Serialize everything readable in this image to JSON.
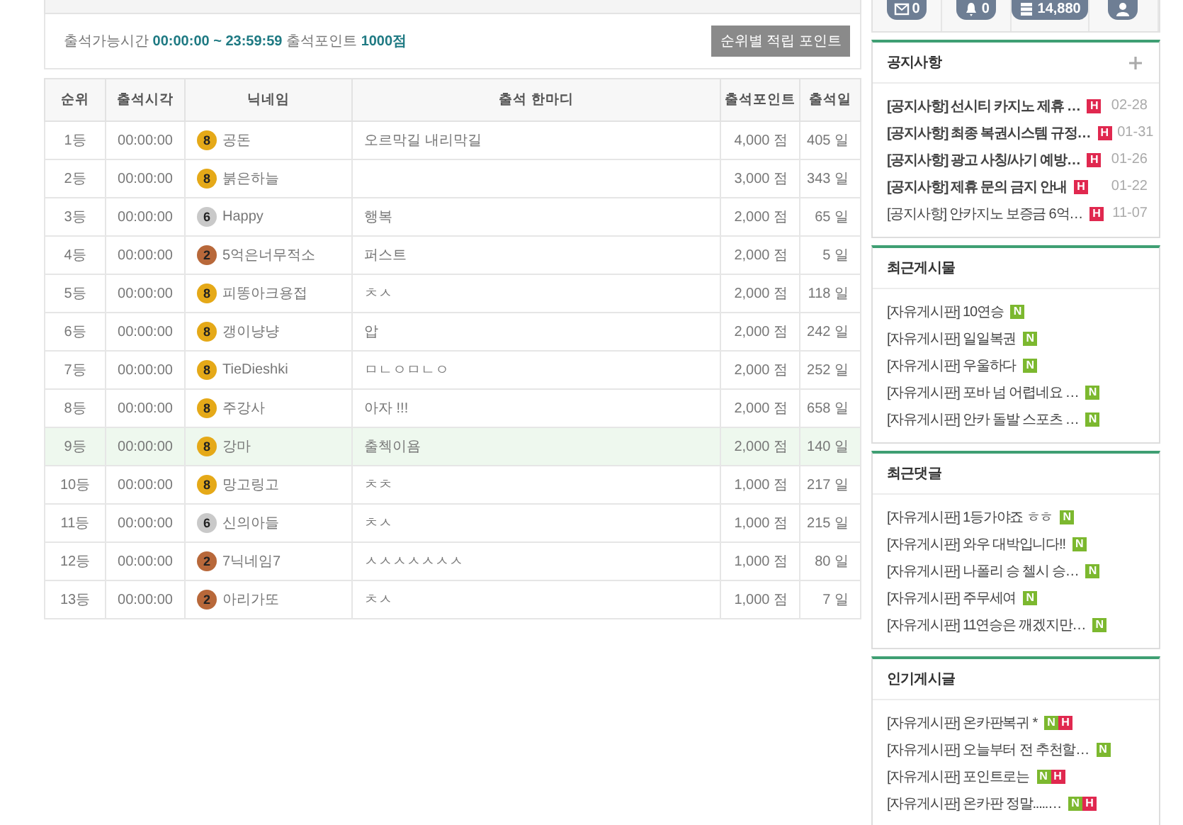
{
  "attendance": {
    "info": "출석가능시간 **00:00:00 ~ 23:59:59** 출석포인트 **1000점**",
    "button": "순위별 적립 포인트"
  },
  "table": {
    "columns": [
      "순위",
      "출석시각",
      "닉네임",
      "출석 한마디",
      "출석포인트",
      "출석일"
    ],
    "rows": [
      {
        "rank": "1등",
        "time": "00:00:00",
        "level": {
          "label": "8",
          "kind": "gold"
        },
        "nickname": "공돈",
        "comment": "오르막길 내리막길",
        "points": "4,000 점",
        "days": "405 일",
        "selected": false
      },
      {
        "rank": "2등",
        "time": "00:00:00",
        "level": {
          "label": "8",
          "kind": "gold"
        },
        "nickname": "붉은하늘",
        "comment": "",
        "points": "3,000 점",
        "days": "343 일",
        "selected": false
      },
      {
        "rank": "3등",
        "time": "00:00:00",
        "level": {
          "label": "6",
          "kind": "silver"
        },
        "nickname": "Happy",
        "comment": "행복",
        "points": "2,000 점",
        "days": "65 일",
        "selected": false
      },
      {
        "rank": "4등",
        "time": "00:00:00",
        "level": {
          "label": "2",
          "kind": "bronze"
        },
        "nickname": "5억은너무적소",
        "comment": "퍼스트",
        "points": "2,000 점",
        "days": "5 일",
        "selected": false
      },
      {
        "rank": "5등",
        "time": "00:00:00",
        "level": {
          "label": "8",
          "kind": "gold"
        },
        "nickname": "피똥아크용접",
        "comment": "ㅊㅅ",
        "points": "2,000 점",
        "days": "118 일",
        "selected": false
      },
      {
        "rank": "6등",
        "time": "00:00:00",
        "level": {
          "label": "8",
          "kind": "gold"
        },
        "nickname": "갱이냥냥",
        "comment": "압",
        "points": "2,000 점",
        "days": "242 일",
        "selected": false
      },
      {
        "rank": "7등",
        "time": "00:00:00",
        "level": {
          "label": "8",
          "kind": "gold"
        },
        "nickname": "TieDieshki",
        "comment": "ㅁㄴㅇㅁㄴㅇ",
        "points": "2,000 점",
        "days": "252 일",
        "selected": false
      },
      {
        "rank": "8등",
        "time": "00:00:00",
        "level": {
          "label": "8",
          "kind": "gold"
        },
        "nickname": "주강사",
        "comment": "아자 !!!",
        "points": "2,000 점",
        "days": "658 일",
        "selected": false
      },
      {
        "rank": "9등",
        "time": "00:00:00",
        "level": {
          "label": "8",
          "kind": "gold"
        },
        "nickname": "강마",
        "comment": "출첵이욤",
        "points": "2,000 점",
        "days": "140 일",
        "selected": true
      },
      {
        "rank": "10등",
        "time": "00:00:00",
        "level": {
          "label": "8",
          "kind": "gold"
        },
        "nickname": "망고링고",
        "comment": "ㅊㅊ",
        "points": "1,000 점",
        "days": "217 일",
        "selected": false
      },
      {
        "rank": "11등",
        "time": "00:00:00",
        "level": {
          "label": "6",
          "kind": "silver"
        },
        "nickname": "신의아들",
        "comment": "ㅊㅅ",
        "points": "1,000 점",
        "days": "215 일",
        "selected": false
      },
      {
        "rank": "12등",
        "time": "00:00:00",
        "level": {
          "label": "2",
          "kind": "bronze"
        },
        "nickname": "7닉네임7",
        "comment": "ㅅㅅㅅㅅㅅㅅㅅ",
        "points": "1,000 점",
        "days": "80 일",
        "selected": false
      },
      {
        "rank": "13등",
        "time": "00:00:00",
        "level": {
          "label": "2",
          "kind": "bronze"
        },
        "nickname": "아리가또",
        "comment": "ㅊㅅ",
        "points": "1,000 점",
        "days": "7 일",
        "selected": false
      }
    ]
  },
  "stats": [
    {
      "kind": "mail",
      "value": "0"
    },
    {
      "kind": "bell",
      "value": "0"
    },
    {
      "kind": "coins",
      "value": "14,880"
    },
    {
      "kind": "user"
    }
  ],
  "panels": [
    {
      "title": "공지사항",
      "more": true,
      "items": [
        {
          "board": "[공지사항]",
          "title": "선시티 카지노 제휴 …",
          "bold": true,
          "badges": [
            {
              "label": "H",
              "kind": "hot"
            }
          ],
          "date": "02-28"
        },
        {
          "board": "[공지사항]",
          "title": "최종 복권시스템 규정…",
          "bold": true,
          "badges": [
            {
              "label": "H",
              "kind": "hot"
            }
          ],
          "date": "01-31"
        },
        {
          "board": "[공지사항]",
          "title": "광고 사칭/사기 예방…",
          "bold": true,
          "badges": [
            {
              "label": "H",
              "kind": "hot"
            }
          ],
          "date": "01-26"
        },
        {
          "board": "[공지사항]",
          "title": "제휴 문의 금지 안내",
          "bold": true,
          "badges": [
            {
              "label": "H",
              "kind": "hot"
            }
          ],
          "date": "01-22"
        },
        {
          "board": "[공지사항]",
          "title": "안카지노 보증금 6억…",
          "bold": false,
          "badges": [
            {
              "label": "H",
              "kind": "hot"
            }
          ],
          "date": "11-07"
        }
      ]
    },
    {
      "title": "최근게시물",
      "more": false,
      "items": [
        {
          "board": "[자유게시판]",
          "title": "10연승",
          "bold": false,
          "badges": [
            {
              "label": "N",
              "kind": "new"
            }
          ]
        },
        {
          "board": "[자유게시판]",
          "title": "일일복권",
          "bold": false,
          "badges": [
            {
              "label": "N",
              "kind": "new"
            }
          ]
        },
        {
          "board": "[자유게시판]",
          "title": "우울하다",
          "bold": false,
          "badges": [
            {
              "label": "N",
              "kind": "new"
            }
          ]
        },
        {
          "board": "[자유게시판]",
          "title": "포바 넘 어렵네요 …",
          "bold": false,
          "badges": [
            {
              "label": "N",
              "kind": "new"
            }
          ]
        },
        {
          "board": "[자유게시판]",
          "title": "안카 돌발 스포츠 …",
          "bold": false,
          "badges": [
            {
              "label": "N",
              "kind": "new"
            }
          ]
        }
      ]
    },
    {
      "title": "최근댓글",
      "more": false,
      "items": [
        {
          "board": "[자유게시판]",
          "title": "1등가야죠 ㅎㅎ",
          "bold": false,
          "badges": [
            {
              "label": "N",
              "kind": "new"
            }
          ]
        },
        {
          "board": "[자유게시판]",
          "title": "와우 대박입니다!!",
          "bold": false,
          "badges": [
            {
              "label": "N",
              "kind": "new"
            }
          ]
        },
        {
          "board": "[자유게시판]",
          "title": "나폴리 승 첼시 승…",
          "bold": false,
          "badges": [
            {
              "label": "N",
              "kind": "new"
            }
          ]
        },
        {
          "board": "[자유게시판]",
          "title": "주무세여",
          "bold": false,
          "badges": [
            {
              "label": "N",
              "kind": "new"
            }
          ]
        },
        {
          "board": "[자유게시판]",
          "title": "11연승은 깨겠지만…",
          "bold": false,
          "badges": [
            {
              "label": "N",
              "kind": "new"
            }
          ]
        }
      ]
    },
    {
      "title": "인기게시글",
      "more": false,
      "items": [
        {
          "board": "[자유게시판]",
          "title": "온카판복귀 *",
          "bold": false,
          "badges": [
            {
              "label": "N",
              "kind": "new"
            },
            {
              "label": "H",
              "kind": "hot"
            }
          ]
        },
        {
          "board": "[자유게시판]",
          "title": "오늘부터 전 추천할…",
          "bold": false,
          "badges": [
            {
              "label": "N",
              "kind": "new"
            }
          ]
        },
        {
          "board": "[자유게시판]",
          "title": "포인트로는",
          "bold": false,
          "badges": [
            {
              "label": "N",
              "kind": "new"
            },
            {
              "label": "H",
              "kind": "hot"
            }
          ]
        },
        {
          "board": "[자유게시판]",
          "title": "온카판 정말.....…",
          "bold": false,
          "badges": [
            {
              "label": "N",
              "kind": "new"
            },
            {
              "label": "H",
              "kind": "hot"
            }
          ]
        }
      ]
    }
  ]
}
